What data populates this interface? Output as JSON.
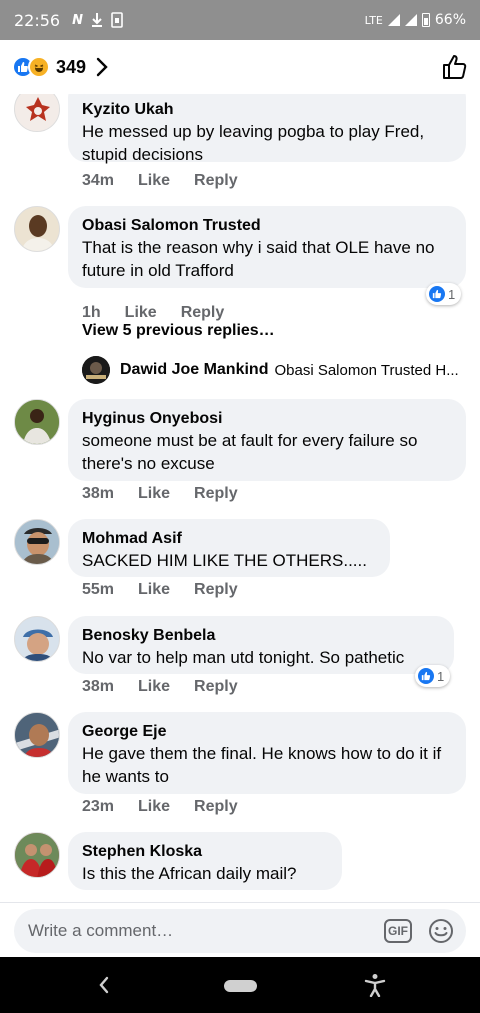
{
  "status_bar": {
    "time": "22:56",
    "network": "LTE",
    "battery": "66%"
  },
  "header": {
    "reaction_count": "349",
    "reactions": [
      "like",
      "haha"
    ]
  },
  "comments": [
    {
      "author": "Kyzito Ukah",
      "text": "He messed up by leaving pogba to play Fred, stupid decisions",
      "time": "34m",
      "like": "Like",
      "reply": "Reply"
    },
    {
      "author": "Obasi Salomon Trusted",
      "text": "That is the reason why i said that OLE have no future in old Trafford",
      "time": "1h",
      "like": "Like",
      "reply": "Reply",
      "reactions": "1"
    },
    {
      "author": "Hyginus Onyebosi",
      "text": "someone must be at fault for every failure so there's no excuse",
      "time": "38m",
      "like": "Like",
      "reply": "Reply"
    },
    {
      "author": "Mohmad Asif",
      "text": "SACKED HIM LIKE THE OTHERS.....",
      "time": "55m",
      "like": "Like",
      "reply": "Reply"
    },
    {
      "author": "Benosky Benbela",
      "text": "No var to help man utd tonight. So pathetic",
      "time": "38m",
      "like": "Like",
      "reply": "Reply",
      "reactions": "1"
    },
    {
      "author": "George Eje",
      "text": "He gave them the final. He knows how to do it if he wants to",
      "time": "23m",
      "like": "Like",
      "reply": "Reply"
    },
    {
      "author": "Stephen Kloska",
      "text": "Is this the African daily mail?"
    }
  ],
  "thread": {
    "view_previous": "View 5 previous replies…",
    "reply_author": "Dawid Joe Mankind",
    "reply_snippet": "Obasi Salomon Trusted H..."
  },
  "composer": {
    "placeholder": "Write a comment…",
    "gif_label": "GIF"
  },
  "colors": {
    "bubble": "#f0f2f5",
    "secondary_text": "#65676b",
    "like_blue": "#1877f2",
    "status_bar": "#8f8f8f"
  }
}
